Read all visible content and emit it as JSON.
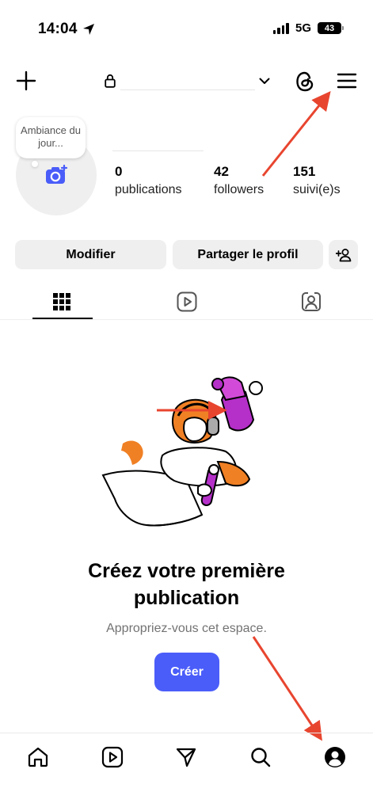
{
  "status_bar": {
    "time": "14:04",
    "network": "5G",
    "battery": "43"
  },
  "header": {
    "new_icon": "plus-icon",
    "lock_icon": "lock-icon",
    "username": "",
    "dropdown_icon": "chevron-down-icon",
    "threads_icon": "threads-icon",
    "menu_icon": "hamburger-menu-icon"
  },
  "profile": {
    "note_bubble": "Ambiance du jour...",
    "name": "",
    "stats": [
      {
        "value": "0",
        "label": "publications"
      },
      {
        "value": "42",
        "label": "followers"
      },
      {
        "value": "151",
        "label": "suivi(e)s"
      }
    ]
  },
  "actions": {
    "edit_label": "Modifier",
    "share_label": "Partager le profil",
    "add_user_icon": "add-person-icon"
  },
  "tabs": [
    {
      "icon": "grid-icon",
      "active": true
    },
    {
      "icon": "reels-icon",
      "active": false
    },
    {
      "icon": "tagged-icon",
      "active": false
    }
  ],
  "empty_state": {
    "title_line1": "Créez votre première",
    "title_line2": "publication",
    "subtitle": "Appropriez-vous cet espace.",
    "cta_label": "Créer"
  },
  "bottom_nav": [
    {
      "icon": "home-icon"
    },
    {
      "icon": "reels-icon"
    },
    {
      "icon": "send-icon"
    },
    {
      "icon": "search-icon"
    },
    {
      "icon": "profile-icon"
    }
  ],
  "colors": {
    "accent": "#4a5df9",
    "annotation_arrow": "#e8452f",
    "illustration_purple": "#b52fc9",
    "illustration_orange": "#f08024"
  }
}
